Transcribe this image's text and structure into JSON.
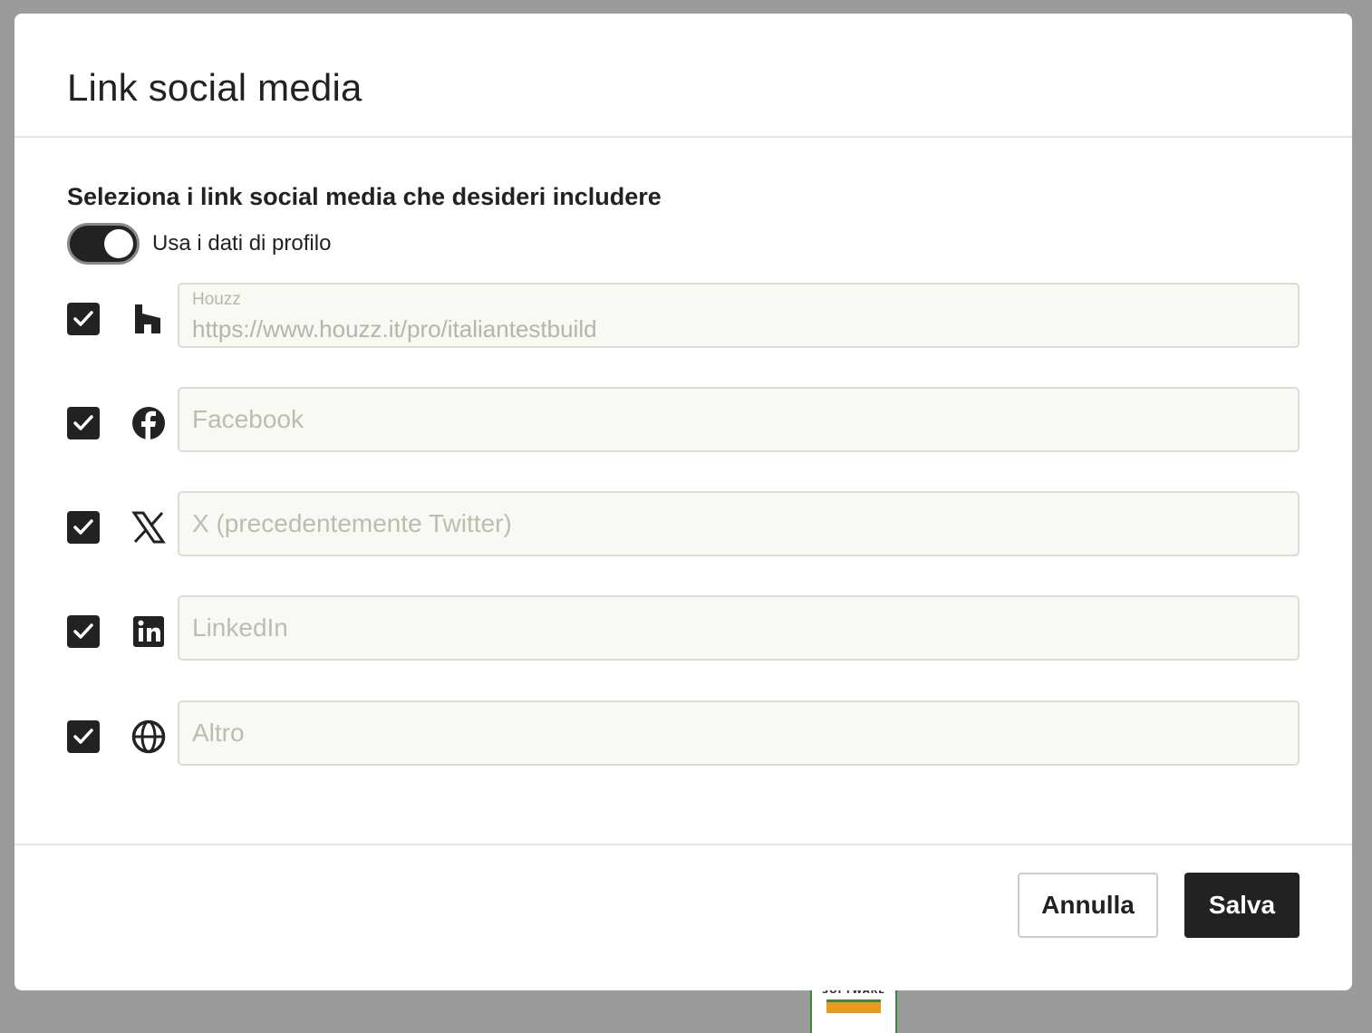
{
  "background": {
    "badge_text": "SOFTWARE"
  },
  "modal": {
    "title": "Link social media",
    "section_label": "Seleziona i link social media che desideri includere",
    "toggle": {
      "label": "Usa i dati di profilo",
      "checked": true
    },
    "rows": [
      {
        "icon": "houzz-icon",
        "label": "Houzz",
        "value": "https://www.houzz.it/pro/italiantestbuild",
        "placeholder": "",
        "checked": true
      },
      {
        "icon": "facebook-icon",
        "label": "",
        "value": "",
        "placeholder": "Facebook",
        "checked": true
      },
      {
        "icon": "x-twitter-icon",
        "label": "",
        "value": "",
        "placeholder": "X (precedentemente Twitter)",
        "checked": true
      },
      {
        "icon": "linkedin-icon",
        "label": "",
        "value": "",
        "placeholder": "LinkedIn",
        "checked": true
      },
      {
        "icon": "globe-icon",
        "label": "",
        "value": "",
        "placeholder": "Altro",
        "checked": true
      }
    ],
    "footer": {
      "cancel_label": "Annulla",
      "save_label": "Salva"
    }
  },
  "colors": {
    "primary": "#222222",
    "field_bg": "#f8f8f5",
    "field_border": "#dcdcd0",
    "placeholder": "#bdbdae",
    "overlay": "#9b9b9b"
  }
}
